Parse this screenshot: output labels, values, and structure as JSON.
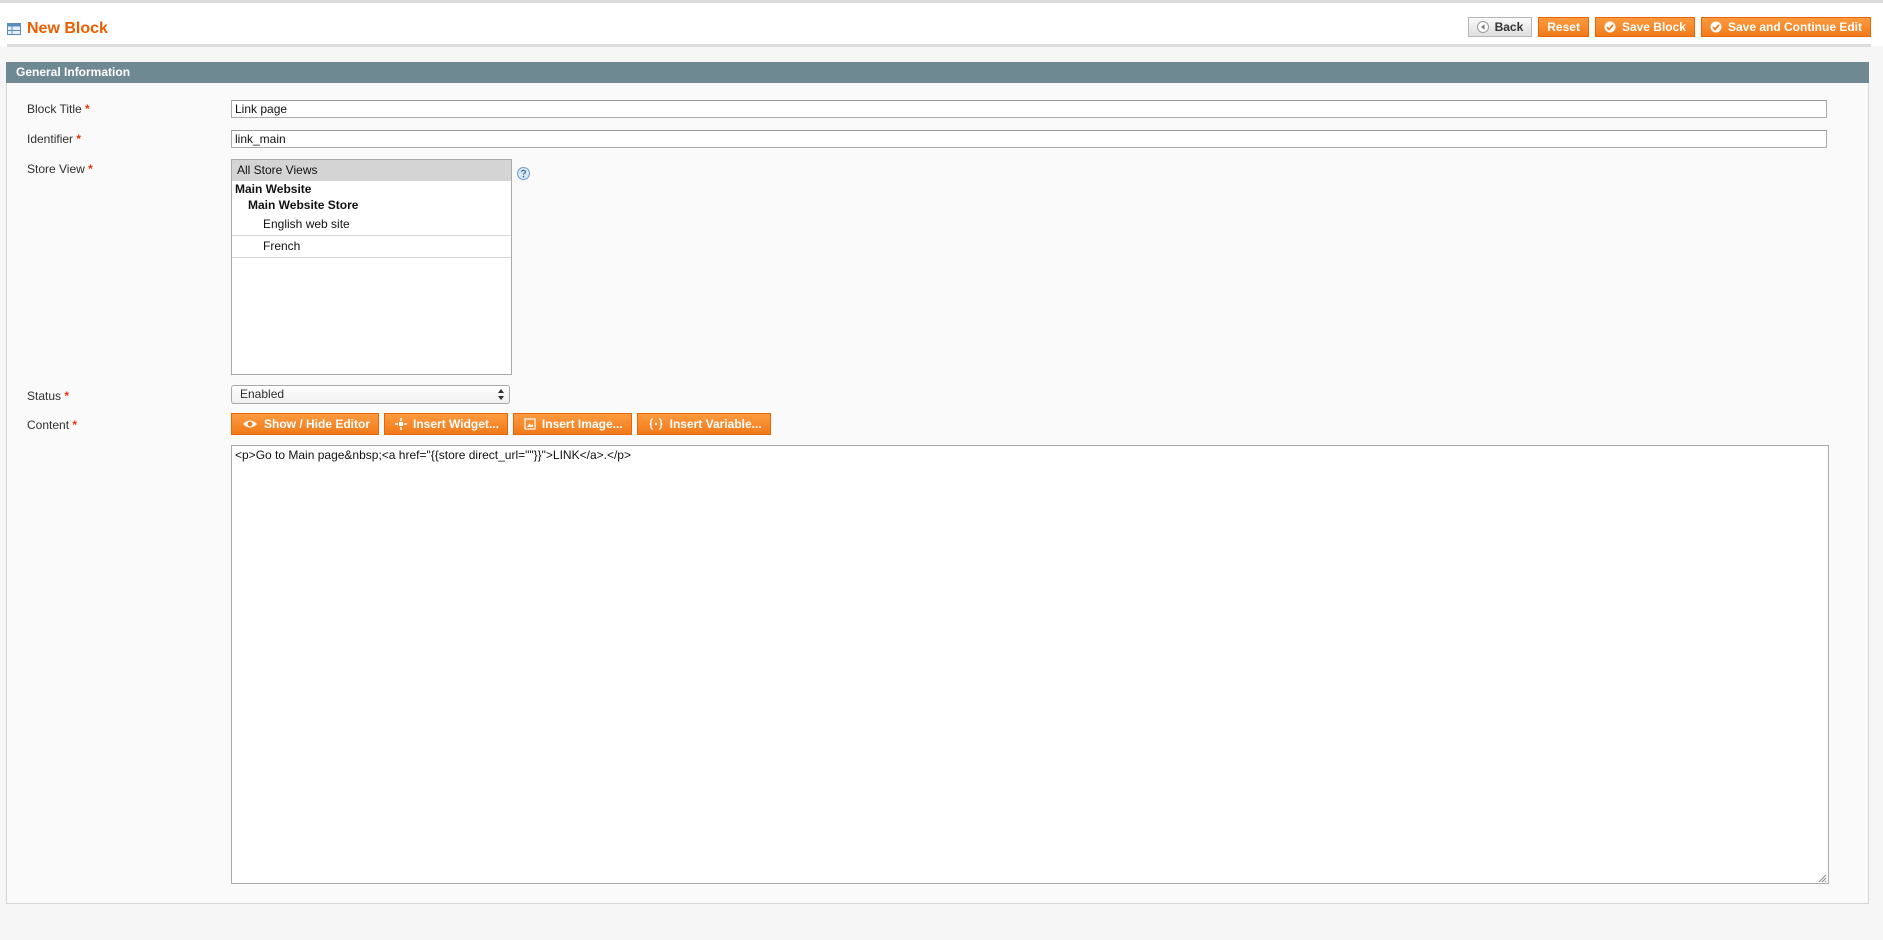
{
  "header": {
    "title": "New Block",
    "title_icon": "cms-block-icon",
    "buttons": {
      "back": "Back",
      "reset": "Reset",
      "save_block": "Save Block",
      "save_continue": "Save and Continue Edit"
    }
  },
  "section": {
    "title": "General Information"
  },
  "form": {
    "required_mark": "*",
    "block_title": {
      "label": "Block Title",
      "value": "Link page"
    },
    "identifier": {
      "label": "Identifier",
      "value": "link_main"
    },
    "store_view": {
      "label": "Store View",
      "options": [
        {
          "label": "All Store Views",
          "kind": "option",
          "selected": true
        },
        {
          "label": "Main Website",
          "kind": "group"
        },
        {
          "label": "Main Website Store",
          "kind": "subgroup"
        },
        {
          "label": "English web site",
          "kind": "option",
          "selected": false
        },
        {
          "label": "French",
          "kind": "option",
          "selected": false
        }
      ]
    },
    "status": {
      "label": "Status",
      "value": "Enabled"
    },
    "content": {
      "label": "Content",
      "buttons": {
        "show_hide_editor": "Show / Hide Editor",
        "insert_widget": "Insert Widget...",
        "insert_image": "Insert Image...",
        "insert_variable": "Insert Variable..."
      },
      "value": "<p>Go to Main page&nbsp;<a href=\"{{store direct_url=\"\"}}\">LINK</a>.</p>"
    }
  },
  "colors": {
    "accent": "#eb5e00",
    "button_orange": "#f58a25",
    "section_header": "#6f8992",
    "required": "#eb340a"
  }
}
